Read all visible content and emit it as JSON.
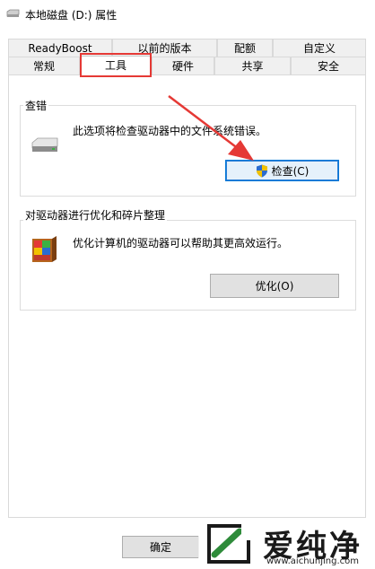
{
  "window": {
    "title": "本地磁盘 (D:) 属性"
  },
  "tabs": {
    "row1": [
      {
        "label": "ReadyBoost"
      },
      {
        "label": "以前的版本"
      },
      {
        "label": "配额"
      },
      {
        "label": "自定义"
      }
    ],
    "row2": [
      {
        "label": "常规"
      },
      {
        "label": "工具",
        "selected": true
      },
      {
        "label": "硬件"
      },
      {
        "label": "共享"
      },
      {
        "label": "安全"
      }
    ]
  },
  "error_check": {
    "group_title": "查错",
    "description": "此选项将检查驱动器中的文件系统错误。",
    "button_label": "检查(C)",
    "icon": "drive-icon",
    "button_icon": "uac-shield-icon"
  },
  "optimize": {
    "group_title": "对驱动器进行优化和碎片整理",
    "description": "优化计算机的驱动器可以帮助其更高效运行。",
    "button_label": "优化(O)",
    "icon": "defrag-icon"
  },
  "footer": {
    "ok_label": "确定"
  },
  "watermark": {
    "brand": "爱纯净",
    "url": "www.aichunjing.com"
  },
  "colors": {
    "annotation_red": "#e53935",
    "button_focus_border": "#0078d7",
    "watermark_green": "#2e8b3a"
  }
}
